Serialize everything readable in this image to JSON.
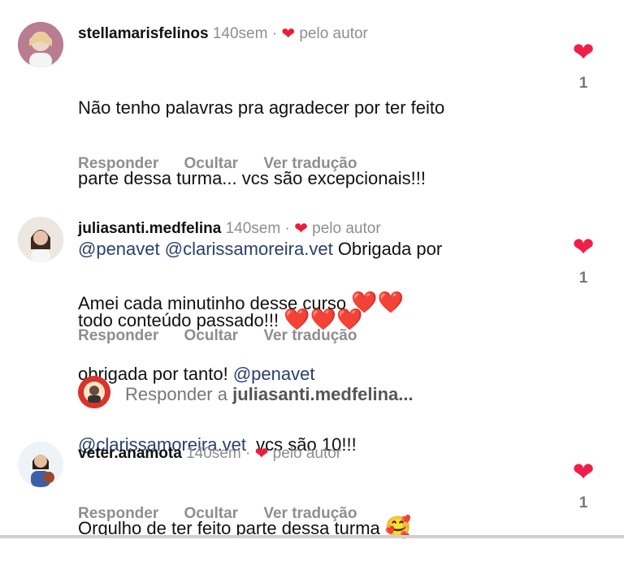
{
  "comments": [
    {
      "username": "stellamarisfelinos",
      "time": "140sem",
      "author_liked": "pelo autor",
      "text_lines": [
        "Não tenho palavras pra agradecer por ter feito",
        "parte dessa turma... vcs são excepcionais!!!"
      ],
      "mentions": [
        "@penavet",
        "@clarissamoreira.vet"
      ],
      "text_after": "Obrigada por",
      "text_last": "todo conteúdo passado!!!",
      "emoji": "❤️❤️❤️",
      "like_count": "1"
    },
    {
      "username": "juliasanti.medfelina",
      "time": "140sem",
      "author_liked": "pelo autor",
      "text_line1": "Amei cada minutinho desse curso",
      "emoji": "❤️❤️",
      "text_line2": "obrigada por tanto!",
      "mention1": "@penavet",
      "mention2": "@clarissamoreira.vet",
      "text_after": "vcs são 10!!!",
      "like_count": "1"
    },
    {
      "username": "veter.anamota",
      "time": "140sem",
      "author_liked": "pelo autor",
      "text": "Orgulho de ter feito parte dessa turma",
      "emoji": "🥰",
      "like_count": "1"
    }
  ],
  "actions": {
    "reply": "Responder",
    "hide": "Ocultar",
    "translate": "Ver tradução"
  },
  "reply_prompt": {
    "prefix": "Responder a",
    "target": "juliasanti.medfelina..."
  },
  "icons": {
    "like": "heart-icon",
    "author_like": "small-heart-icon"
  },
  "colors": {
    "heart": "#ef1f47",
    "mention": "#2a3f6e",
    "muted": "#8e8e8e"
  }
}
